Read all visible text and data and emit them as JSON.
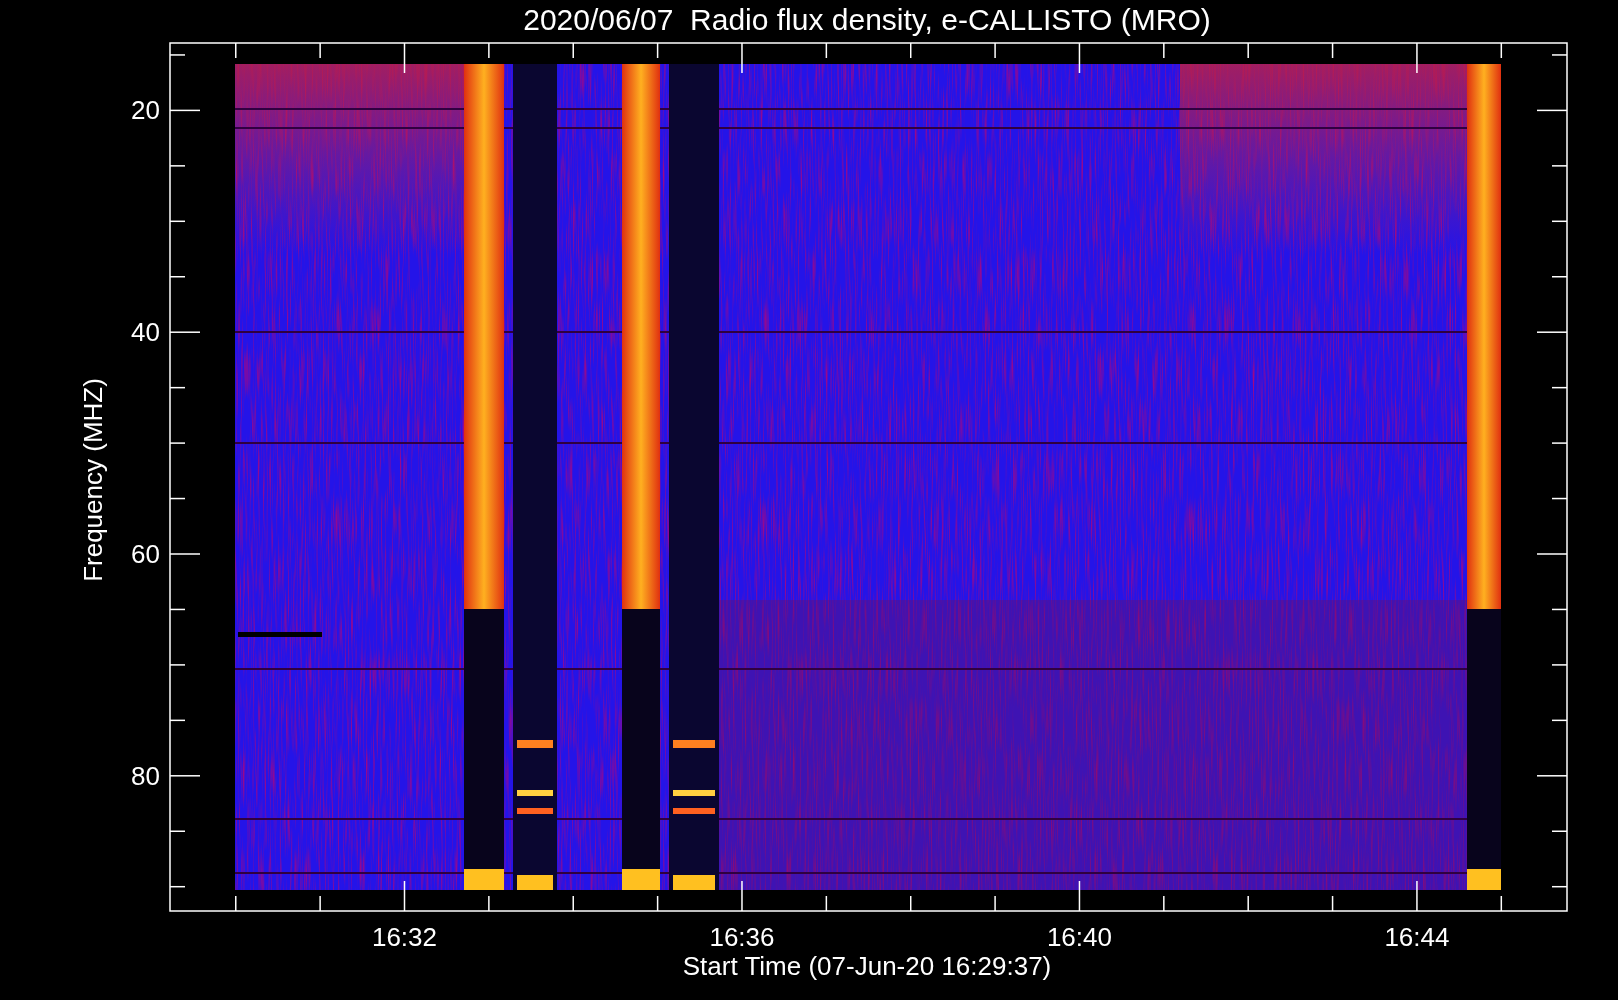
{
  "title": "2020/06/07  Radio flux density, e-CALLISTO (MRO)",
  "y_axis": {
    "label": "Frequency (MHZ)",
    "ticks": [
      "20",
      "40",
      "60",
      "80"
    ]
  },
  "x_axis": {
    "label": "Start Time (07-Jun-20 16:29:37)",
    "ticks": [
      "16:32",
      "16:36",
      "16:40",
      "16:44"
    ]
  }
}
